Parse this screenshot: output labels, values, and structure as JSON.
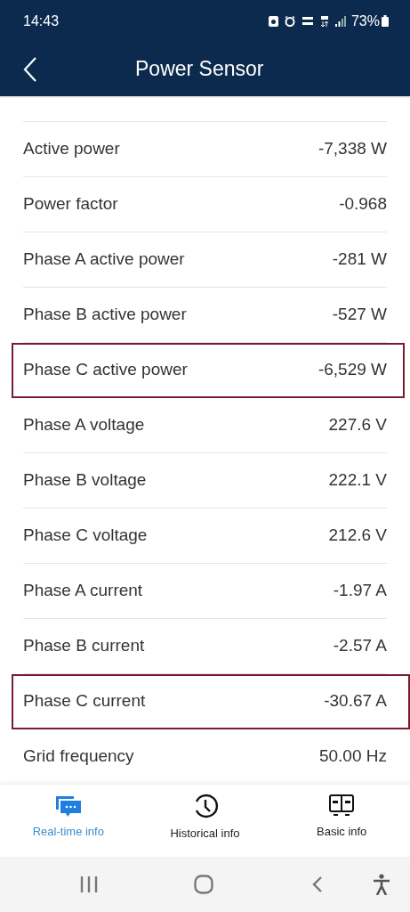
{
  "status_bar": {
    "time": "14:43",
    "battery": "73%"
  },
  "header": {
    "title": "Power Sensor"
  },
  "rows": [
    {
      "label": "Active power",
      "value": "-7,338 W",
      "highlighted": false
    },
    {
      "label": "Power factor",
      "value": "-0.968",
      "highlighted": false
    },
    {
      "label": "Phase A active power",
      "value": "-281 W",
      "highlighted": false
    },
    {
      "label": "Phase B active power",
      "value": "-527 W",
      "highlighted": false
    },
    {
      "label": "Phase C active power",
      "value": "-6,529 W",
      "highlighted": true
    },
    {
      "label": "Phase A voltage",
      "value": "227.6 V",
      "highlighted": false
    },
    {
      "label": "Phase B voltage",
      "value": "222.1 V",
      "highlighted": false
    },
    {
      "label": "Phase C voltage",
      "value": "212.6 V",
      "highlighted": false
    },
    {
      "label": "Phase A current",
      "value": "-1.97 A",
      "highlighted": false
    },
    {
      "label": "Phase B current",
      "value": "-2.57 A",
      "highlighted": false
    },
    {
      "label": "Phase C current",
      "value": "-30.67 A",
      "highlighted": true
    },
    {
      "label": "Grid frequency",
      "value": "50.00 Hz",
      "highlighted": false
    }
  ],
  "tabs": [
    {
      "label": "Real-time info",
      "kind": "chat",
      "selected": true
    },
    {
      "label": "Historical info",
      "kind": "clock",
      "selected": false
    },
    {
      "label": "Basic info",
      "kind": "device",
      "selected": false
    }
  ]
}
